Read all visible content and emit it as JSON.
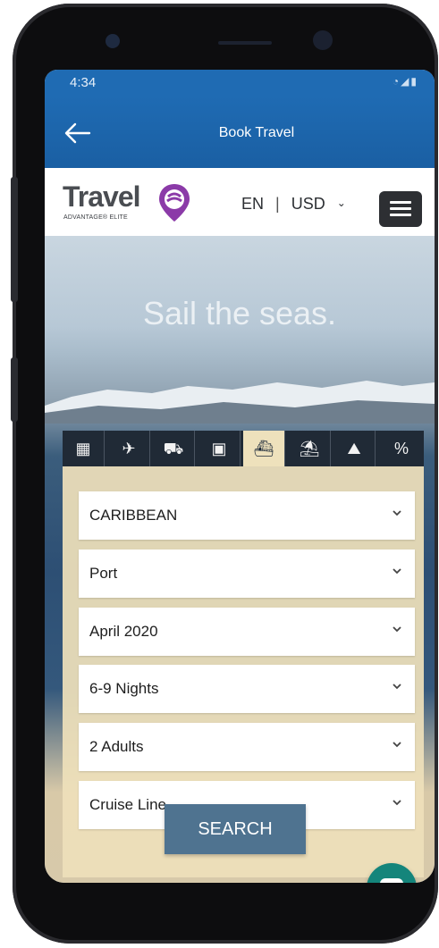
{
  "status_bar": {
    "time": "4:34",
    "icons": [
      "wifi-icon",
      "signal-icon",
      "battery-icon"
    ]
  },
  "app_bar": {
    "title": "Book Travel",
    "back_icon": "arrow-left-icon"
  },
  "header": {
    "logo_text": "Travel",
    "logo_subtext": "ADVANTAGE® ELITE",
    "language": "EN",
    "currency": "USD",
    "menu_icon": "hamburger-icon"
  },
  "hero": {
    "title": "Sail the seas."
  },
  "category_tabs": [
    {
      "icon": "hotel-icon",
      "glyph": "▦",
      "active": false
    },
    {
      "icon": "flight-icon",
      "glyph": "✈",
      "active": false
    },
    {
      "icon": "car-icon",
      "glyph": "⛟",
      "active": false
    },
    {
      "icon": "train-icon",
      "glyph": "▣",
      "active": false
    },
    {
      "icon": "cruise-icon",
      "glyph": "⛴",
      "active": true
    },
    {
      "icon": "beach-umbrella-icon",
      "glyph": "⛱",
      "active": false
    },
    {
      "icon": "activities-icon",
      "glyph": "⛰",
      "active": false
    },
    {
      "icon": "discount-icon",
      "glyph": "%",
      "active": false
    }
  ],
  "form": {
    "destination": "CARIBBEAN",
    "port": "Port",
    "date": "April 2020",
    "nights": "6-9 Nights",
    "guests": "2 Adults",
    "cruise_line": "Cruise Line"
  },
  "search_button": "SEARCH",
  "colors": {
    "primary": "#1f6bb3",
    "button": "#4f7390",
    "panel": "#eee0ba",
    "chat": "#14857b"
  }
}
